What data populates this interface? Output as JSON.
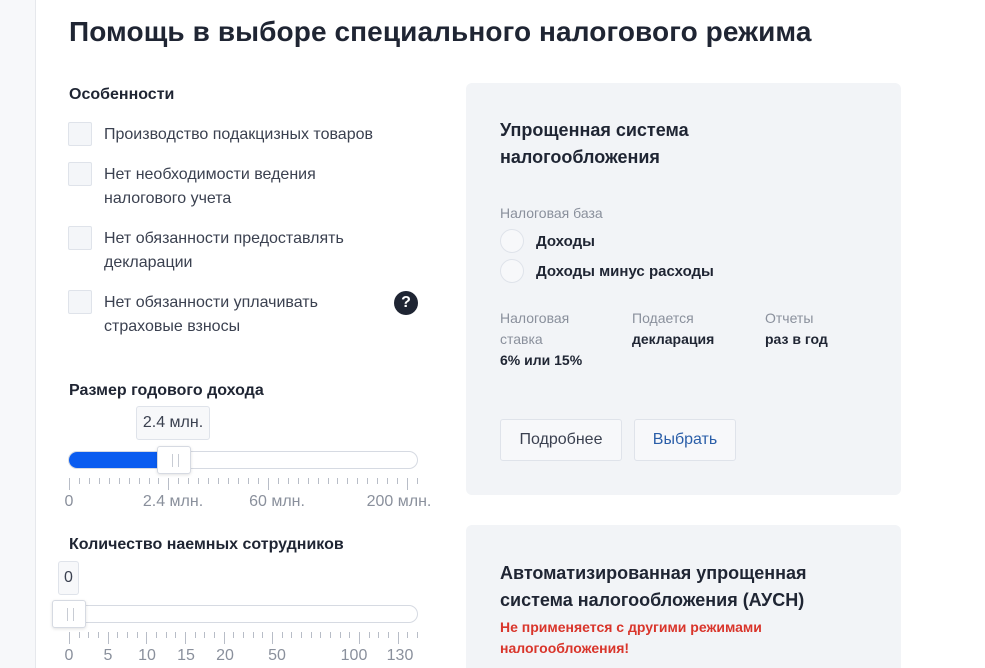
{
  "page_title": "Помощь в выборе специального налогового режима",
  "features": {
    "title": "Особенности",
    "items": [
      {
        "label": "Производство подакцизных товаров",
        "checked": false
      },
      {
        "label": "Нет необходимости ведения налогового учета",
        "checked": false
      },
      {
        "label": "Нет обязанности предоставлять декларации",
        "checked": false
      },
      {
        "label": "Нет обязанности уплачивать страховые взносы",
        "checked": false
      }
    ],
    "help_icon": "?"
  },
  "income": {
    "title": "Размер годового дохода",
    "current": "2.4 млн.",
    "scale": [
      "0",
      "2.4 млн.",
      "60 млн.",
      "200 млн."
    ]
  },
  "employees": {
    "title": "Количество наемных сотрудников",
    "current": "0",
    "scale": [
      "0",
      "5",
      "10",
      "15",
      "20",
      "50",
      "100",
      "130"
    ]
  },
  "card_usn": {
    "title_line1": "Упрощенная система",
    "title_line2": "налогообложения",
    "base_label": "Налоговая база",
    "options": [
      "Доходы",
      "Доходы минус расходы"
    ],
    "info": [
      {
        "label_line1": "Налоговая",
        "label_line2": "ставка",
        "value": "6% или 15%"
      },
      {
        "label_line1": "Подается",
        "label_line2": "",
        "value": "декларация"
      },
      {
        "label_line1": "Отчеты",
        "label_line2": "",
        "value": "раз в год"
      }
    ],
    "details_button": "Подробнее",
    "choose_button": "Выбрать"
  },
  "card_ausn": {
    "title_line1": "Автоматизированная упрощенная",
    "title_line2": "система налогообложения (АУСН)",
    "warning_line1": "Не применяется с другими режимами",
    "warning_line2": "налогообложения!"
  },
  "colors": {
    "accent": "#0a5cf0",
    "card_bg": "#f2f4f7",
    "warning": "#d9352b",
    "link": "#2a5ea8"
  }
}
